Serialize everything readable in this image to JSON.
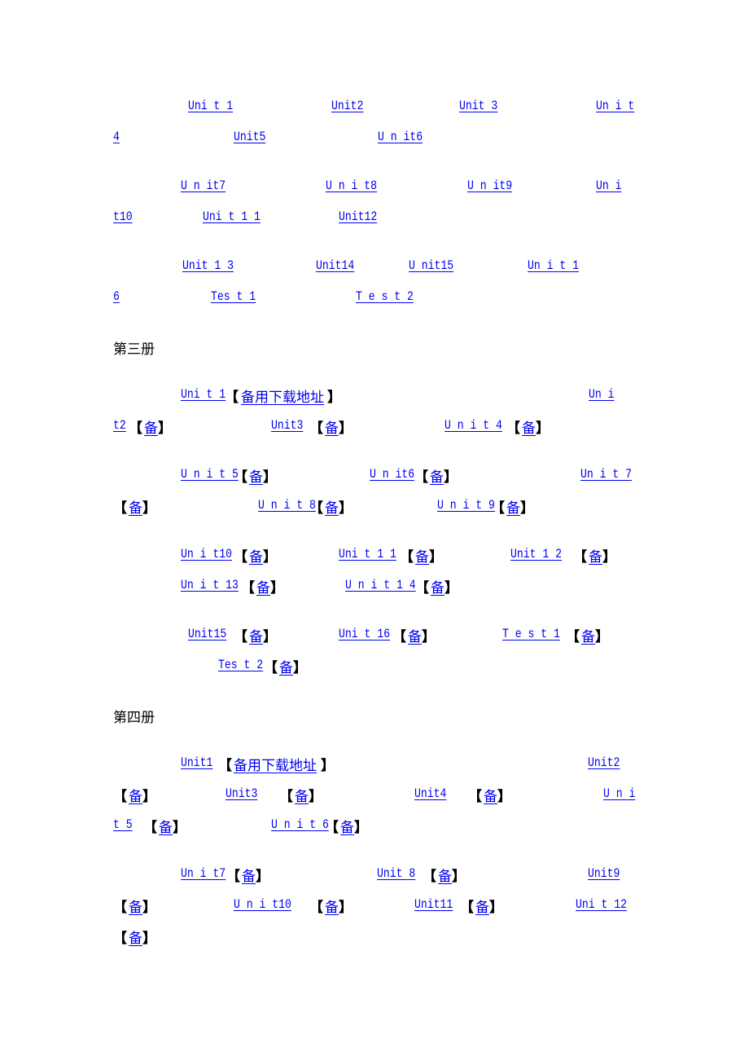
{
  "book2_links": {
    "row1": [
      "Uni t 1",
      "Unit2",
      "Unit 3 ",
      "Un i t"
    ],
    "row2": [
      "4 ",
      "Unit5",
      "U n it6"
    ],
    "row3": [
      "U n it7",
      "U  n  i t8",
      "U n it9",
      "Un i "
    ],
    "row4": [
      "t10",
      "Uni t 1 1 ",
      "Unit12"
    ],
    "row5": [
      "Unit 1 3",
      "Unit14",
      "U nit15",
      "Un i t 1 "
    ],
    "row6": [
      "6",
      "Tes t  1 ",
      "T e s t 2"
    ]
  },
  "book3": {
    "heading": "第三册",
    "bracket_open": "【",
    "bracket_close": "】",
    "alt_short": "备",
    "alt_long": "备用下载地址",
    "row1": [
      "Uni t 1",
      "Un i "
    ],
    "row2": [
      "t2",
      "Unit3",
      "U n  i  t 4"
    ],
    "row3": [
      "U n i t 5",
      "U n it6",
      "Un i  t 7"
    ],
    "row4": [
      "U n i t 8",
      "U n i t 9"
    ],
    "row5": [
      "Un i t10",
      "Uni t 1 1 ",
      " Unit 1 2"
    ],
    "row6": [
      "Un i  t 13",
      " U n i t 1 4"
    ],
    "row7": [
      "Unit15",
      "Uni t 16",
      " T e s t  1 "
    ],
    "row8": [
      "Tes t 2"
    ]
  },
  "book4": {
    "heading": "第四册",
    "bracket_open": "【",
    "bracket_close": "】",
    "alt_short": "备",
    "alt_long": "备用下载地址",
    "row1": [
      "Unit1",
      "Unit2"
    ],
    "row2": [
      "Unit3",
      "Unit4",
      "U n i"
    ],
    "row3": [
      " t  5 ",
      "U n i t 6"
    ],
    "row4": [
      "Un i t7",
      "Unit 8 ",
      "Unit9"
    ],
    "row5": [
      "U n  i t10",
      "Unit11",
      "Uni t 12"
    ]
  }
}
